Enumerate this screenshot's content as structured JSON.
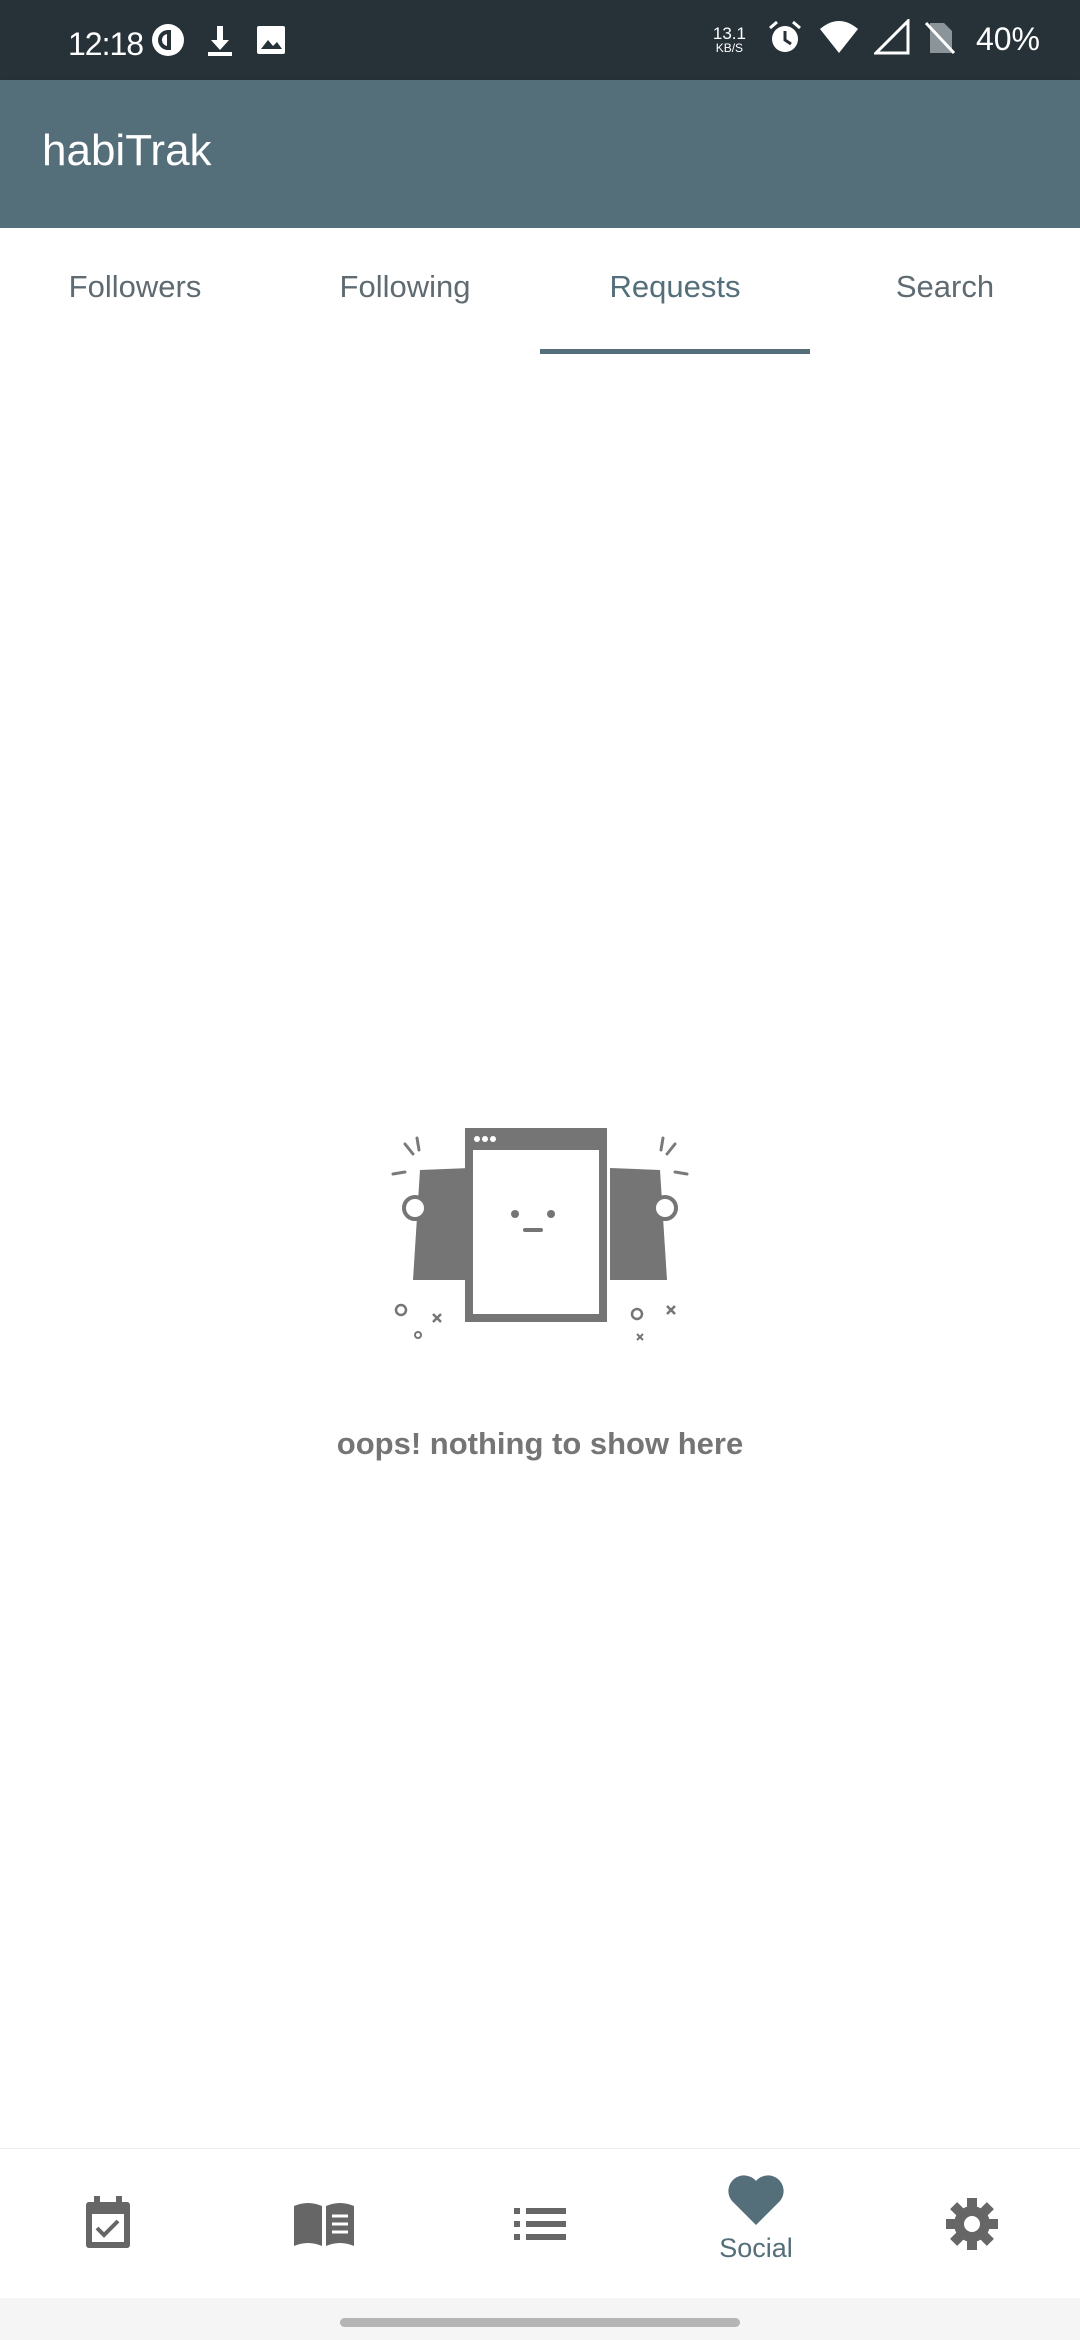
{
  "status_bar": {
    "time": "12:18",
    "net_speed_value": "13.1",
    "net_speed_unit": "KB/S",
    "battery": "40%",
    "left_icons": [
      "pocket-casts-icon",
      "download-icon",
      "image-icon"
    ],
    "right_icons": [
      "alarm-icon",
      "wifi-icon",
      "signal-icon",
      "no-sim-icon"
    ]
  },
  "app_bar": {
    "title": "habiTrak",
    "color": "#546e7a"
  },
  "tabs": [
    {
      "label": "Followers",
      "active": false
    },
    {
      "label": "Following",
      "active": false
    },
    {
      "label": "Requests",
      "active": true
    },
    {
      "label": "Search",
      "active": false
    }
  ],
  "empty_state": {
    "illustration": "empty-box-icon",
    "message": "oops! nothing to show here"
  },
  "bottom_nav": {
    "items": [
      {
        "icon": "calendar-check-icon",
        "label": ""
      },
      {
        "icon": "journal-book-icon",
        "label": ""
      },
      {
        "icon": "list-icon",
        "label": ""
      },
      {
        "icon": "heart-icon",
        "label": "Social",
        "active": true
      },
      {
        "icon": "gear-icon",
        "label": ""
      }
    ]
  },
  "colors": {
    "status_bar": "#263238",
    "primary": "#546e7a",
    "text_muted": "#757575"
  }
}
